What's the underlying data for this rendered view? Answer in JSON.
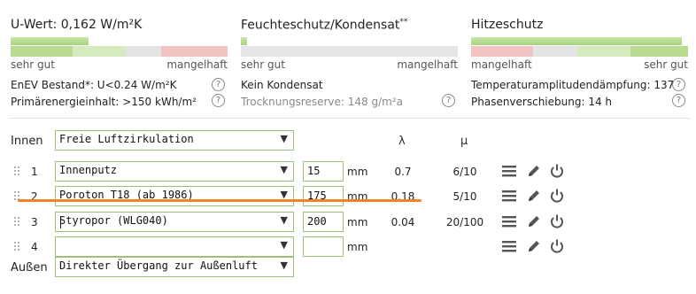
{
  "uwert": {
    "title": "U-Wert: 0,162 W/m²K",
    "scale_left": "sehr gut",
    "scale_right": "mangelhaft",
    "level": 0.36,
    "line1": "EnEV Bestand*: U<0.24 W/m²K",
    "line2": "Primärenergieinhalt: >150 kWh/m²",
    "help_icon": "question-circle-icon"
  },
  "feuchte": {
    "title": "Feuchteschutz/Kondensat",
    "title_sup": "**",
    "scale_left": "sehr gut",
    "scale_right": "mangelhaft",
    "level": 0.03,
    "line1": "Kein Kondensat",
    "line2": "Trocknungsreserve: 148 g/m²a",
    "help_icon": "question-circle-icon"
  },
  "hitze": {
    "title": "Hitzeschutz",
    "scale_left": "mangelhaft",
    "scale_right": "sehr gut",
    "level": 0.97,
    "line1": "Temperaturamplitudendämpfung: 137",
    "line2": "Phasenverschiebung: 14 h",
    "help_icon": "question-circle-icon"
  },
  "table": {
    "col_lambda": "λ",
    "col_mu": "μ",
    "inner": {
      "label": "Innen",
      "value": "Freie Luftzirkulation"
    },
    "outer": {
      "label": "Außen",
      "value": "Direkter Übergang zur Außenluft"
    },
    "unit": "mm",
    "layers": [
      {
        "index": "1",
        "material": "Innenputz",
        "thickness": "15",
        "lambda": "0.7",
        "mu": "6/10"
      },
      {
        "index": "2",
        "material": "Poroton T18 (ab 1986)",
        "thickness": "175",
        "lambda": "0.18",
        "mu": "5/10"
      },
      {
        "index": "3",
        "material": "Styropor (WLG040)",
        "thickness": "200",
        "lambda": "0.04",
        "mu": "20/100"
      },
      {
        "index": "4",
        "material": "",
        "thickness": "",
        "lambda": "",
        "mu": ""
      }
    ],
    "row_icons": [
      "menu-icon",
      "pencil-icon",
      "power-icon"
    ],
    "dropdown_icon": "triangle-down-icon"
  },
  "colors": {
    "good": "#a9d37e",
    "bad": "#e8a3a3",
    "neutral": "#dcdcdc",
    "input_border": "#9cc07a",
    "highlight": "#f0822a"
  }
}
